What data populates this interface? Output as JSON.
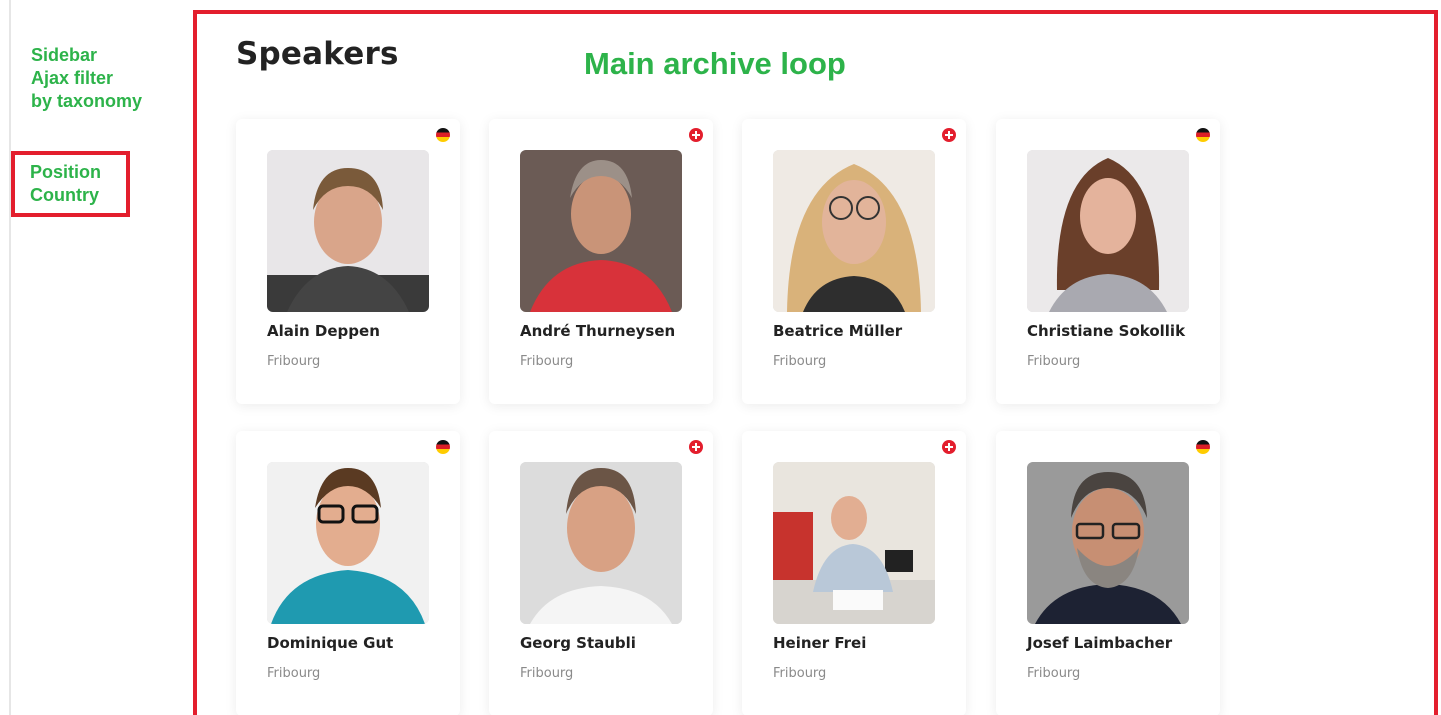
{
  "sidebar": {
    "note_lines": [
      "Sidebar",
      "Ajax filter",
      "by taxonomy"
    ],
    "filter_lines": [
      "Position",
      "Country"
    ]
  },
  "main": {
    "title": "Speakers",
    "note": "Main archive loop"
  },
  "colors": {
    "annotation_green": "#2db34a",
    "annotation_red": "#e31e2d"
  },
  "speakers": [
    {
      "name": "Alain Deppen",
      "city": "Fribourg",
      "flag": "de-flag-icon"
    },
    {
      "name": "André Thurneysen",
      "city": "Fribourg",
      "flag": "ch-flag-icon"
    },
    {
      "name": "Beatrice Müller",
      "city": "Fribourg",
      "flag": "ch-flag-icon"
    },
    {
      "name": "Christiane Sokollik",
      "city": "Fribourg",
      "flag": "de-flag-icon"
    },
    {
      "name": "Dominique Gut",
      "city": "Fribourg",
      "flag": "de-flag-icon"
    },
    {
      "name": "Georg Staubli",
      "city": "Fribourg",
      "flag": "ch-flag-icon"
    },
    {
      "name": "Heiner Frei",
      "city": "Fribourg",
      "flag": "ch-flag-icon"
    },
    {
      "name": "Josef Laimbacher",
      "city": "Fribourg",
      "flag": "de-flag-icon"
    }
  ]
}
